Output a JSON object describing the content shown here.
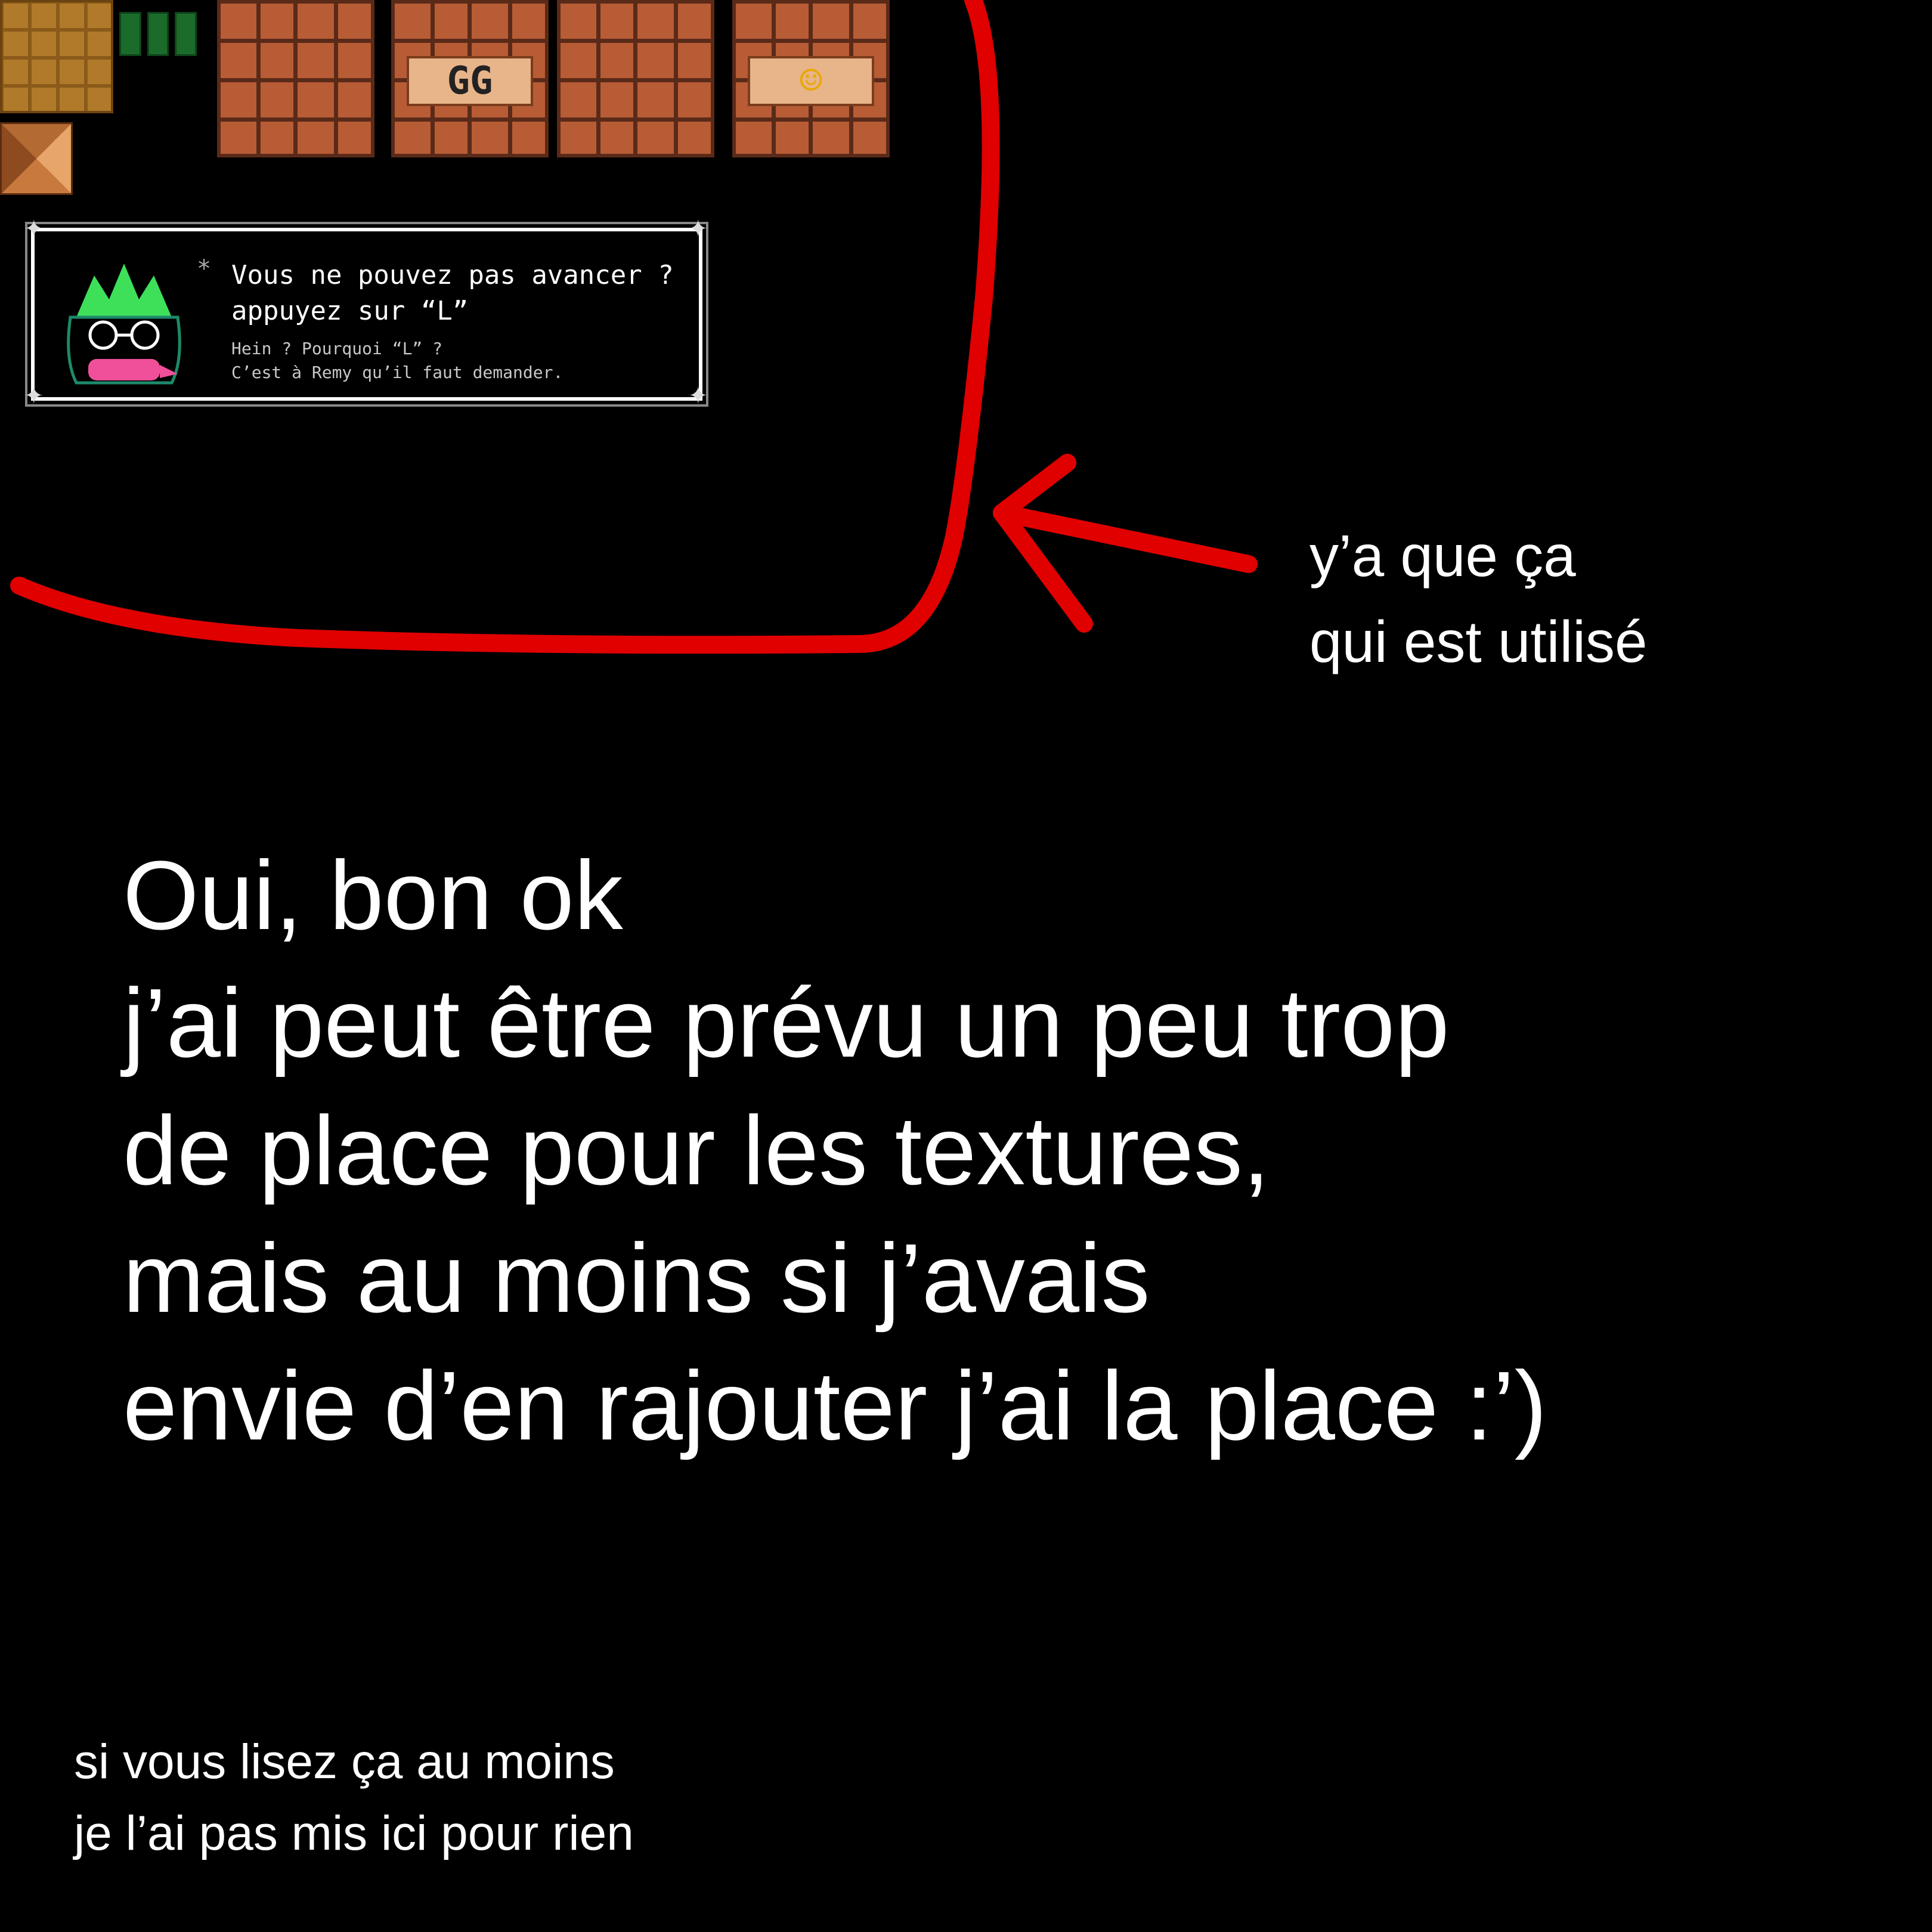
{
  "textures": {
    "plaque_gg": "GG",
    "plaque_smiley": "☺"
  },
  "dialog": {
    "asterisk": "*",
    "line1": "Vous ne pouvez pas avancer ?",
    "line2": "appuyez sur “L”",
    "sub1": "Hein ? Pourquoi “L” ?",
    "sub2": "C’est à Remy qu’il faut demander."
  },
  "note": {
    "line1": "y’a que ça",
    "line2": "qui est utilisé"
  },
  "main_text": {
    "lines": [
      "Oui, bon ok",
      "j’ai peut être prévu un peu trop",
      "de place pour les textures,",
      "mais au moins si j’avais",
      "envie d’en rajouter j’ai la place :’)"
    ]
  },
  "footer": {
    "line1": "si vous lisez ça au moins",
    "line2": "je l’ai pas mis ici pour rien"
  },
  "colors": {
    "background": "#000000",
    "annotation_red": "#e00000",
    "brick": "#b85c36",
    "text": "#ffffff"
  }
}
